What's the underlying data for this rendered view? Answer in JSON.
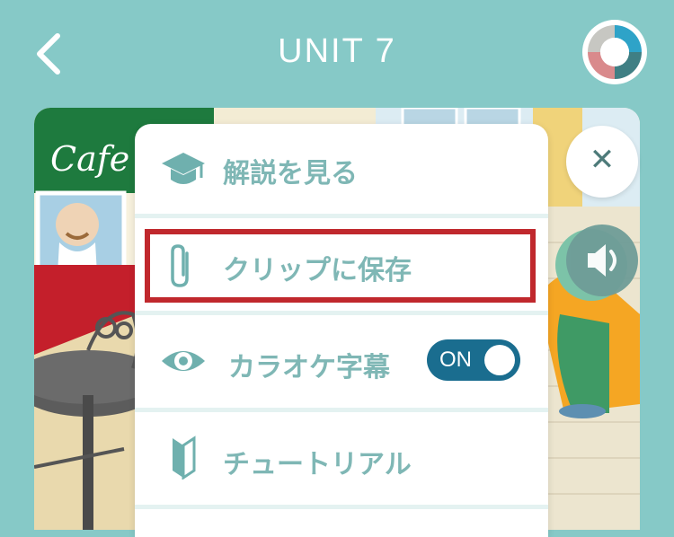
{
  "header": {
    "title": "UNIT 7"
  },
  "scene": {
    "cafe_sign": "Cafe"
  },
  "menu": {
    "items": [
      {
        "label": "解説を見る",
        "icon": "graduation-cap-icon"
      },
      {
        "label": "クリップに保存",
        "icon": "paperclip-icon"
      },
      {
        "label": "カラオケ字幕",
        "icon": "eye-icon",
        "toggle": "ON"
      },
      {
        "label": "チュートリアル",
        "icon": "beginner-mark-icon"
      }
    ]
  },
  "colors": {
    "background": "#86c9c7",
    "menu_text": "#7fb7b5",
    "highlight": "#c0282d",
    "toggle_on": "#1a6d8f"
  }
}
